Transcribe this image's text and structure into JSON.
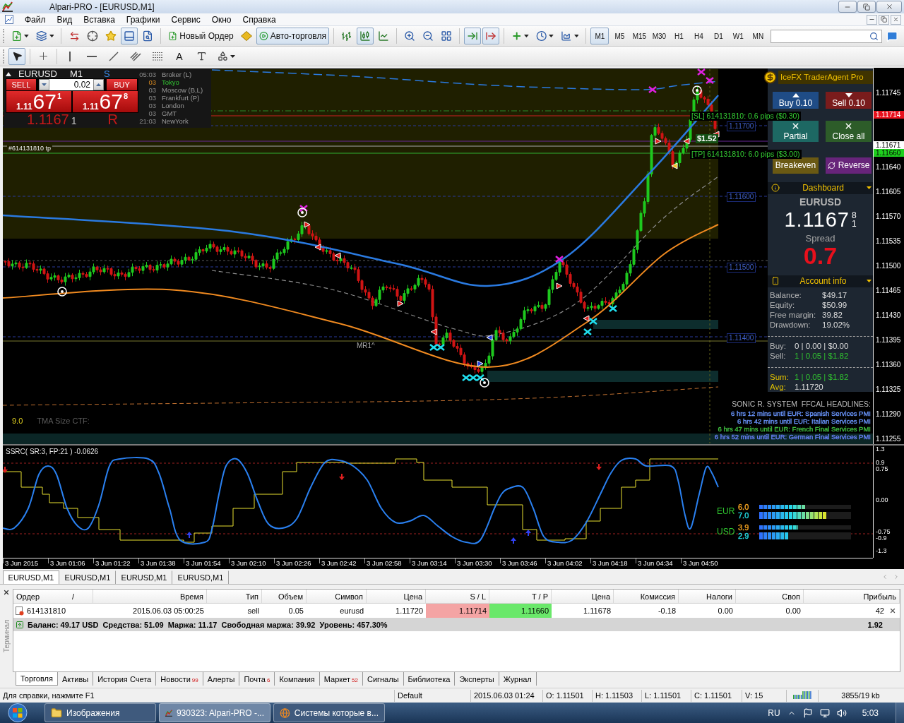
{
  "window": {
    "title": "Alpari-PRO - [EURUSD,M1]"
  },
  "menu": [
    "Файл",
    "Вид",
    "Вставка",
    "Графики",
    "Сервис",
    "Окно",
    "Справка"
  ],
  "toolbar": {
    "terminal_view": {
      "on": true
    },
    "new_order": "Новый Ордер",
    "auto_trading": {
      "label": "Авто-торговля",
      "on": true
    },
    "chart_types": [
      {
        "kind": "bars",
        "selected": false
      },
      {
        "kind": "candles",
        "selected": true
      },
      {
        "kind": "line",
        "selected": false
      }
    ],
    "auto_scroll": {
      "on": true
    },
    "chart_shift": {
      "on": true
    },
    "timeframes": [
      {
        "label": "M1",
        "selected": true
      },
      {
        "label": "M5",
        "selected": false
      },
      {
        "label": "M15",
        "selected": false
      },
      {
        "label": "M30",
        "selected": false
      },
      {
        "label": "H1",
        "selected": false
      },
      {
        "label": "H4",
        "selected": false
      },
      {
        "label": "D1",
        "selected": false
      },
      {
        "label": "W1",
        "selected": false
      },
      {
        "label": "MN",
        "selected": false
      }
    ]
  },
  "drawing_tools": [
    {
      "kind": "cursor",
      "selected": true
    },
    {
      "kind": "crosshair",
      "selected": false
    },
    {
      "kind": "vertical_line",
      "selected": false
    },
    {
      "kind": "horizontal_line",
      "selected": false
    },
    {
      "kind": "trend_line",
      "selected": false
    },
    {
      "kind": "channel",
      "selected": false
    },
    {
      "kind": "fibonacci",
      "selected": false
    },
    {
      "kind": "text",
      "label": "A",
      "selected": false
    },
    {
      "kind": "text_label",
      "selected": false
    },
    {
      "kind": "shapes",
      "selected": false
    }
  ],
  "chart": {
    "symbol": "EURUSD",
    "timeframe": "M1",
    "session_mark": "S",
    "clocks": [
      {
        "time": "05:03",
        "city": "Broker (L)",
        "active": false
      },
      {
        "time": "03",
        "city": "Tokyo",
        "active": true
      },
      {
        "time": "03",
        "city": "Moscow (B,L)",
        "active": false
      },
      {
        "time": "03",
        "city": "Frankfurt (P)",
        "active": false
      },
      {
        "time": "03",
        "city": "London",
        "active": false
      },
      {
        "time": "03",
        "city": "GMT",
        "active": false
      },
      {
        "time": "21:03",
        "city": "NewYork",
        "active": false
      }
    ],
    "one_click": {
      "sell_label": "SELL",
      "buy_label": "BUY",
      "lot": "0.02",
      "bid": {
        "handle": "1.11",
        "pips": "67",
        "fraction": "1"
      },
      "ask": {
        "handle": "1.11",
        "pips": "67",
        "fraction": "8"
      }
    },
    "last_price": {
      "price": "1.1167",
      "digit": "1",
      "mark": "R"
    },
    "order_tag": "#614131810 tp",
    "level_tags": [
      "1.11700",
      "1.11600",
      "1.11500",
      "1.11400"
    ],
    "sl_tag": "[SL] 614131810: 0.6 pips ($0.30)",
    "profit_tag": "$1.52",
    "tp_tag": "[TP] 614131810: 6.0 pips ($3.00)",
    "pivot_tag": "MR1^",
    "tma": {
      "value": "9.0",
      "label": "TMA Size CTF:"
    },
    "price_axis": [
      "1.11745",
      "1.11640",
      "1.11605",
      "1.11570",
      "1.11535",
      "1.11500",
      "1.11465",
      "1.11430",
      "1.11395",
      "1.11360",
      "1.11325",
      "1.11290",
      "1.11255"
    ],
    "price_badges": [
      {
        "label": "1.11714",
        "color": "#e8101c"
      },
      {
        "label": "1.11671",
        "color": "#ffffff"
      },
      {
        "label": "1.11660",
        "color": "#1ed01e"
      }
    ]
  },
  "trader_agent": {
    "title": "IceFX TraderAgent Pro",
    "buttons": [
      {
        "kind": "buy",
        "label": "Buy 0.10"
      },
      {
        "kind": "sell",
        "label": "Sell 0.10"
      },
      {
        "kind": "partial",
        "label": "Partial"
      },
      {
        "kind": "close",
        "label": "Close all"
      },
      {
        "kind": "breakeven",
        "label": "Breakeven"
      },
      {
        "kind": "reverse",
        "label": "Reverse"
      }
    ],
    "dashboard": {
      "title": "Dashboard",
      "symbol": "EURUSD",
      "price": "1.1167",
      "price_sup": "8",
      "price_sub": "1",
      "spread_label": "Spread",
      "spread": "0.7"
    },
    "account": {
      "title": "Account info",
      "rows": [
        {
          "label": "Balance:",
          "value": "$49.17"
        },
        {
          "label": "Equity:",
          "value": "$50.99"
        },
        {
          "label": "Free margin:",
          "value": "39.82"
        },
        {
          "label": "Drawdown:",
          "value": "19.02%"
        }
      ],
      "positions": [
        {
          "label": "Buy:",
          "value": "0 | 0.00 | $0.00",
          "positive": false
        },
        {
          "label": "Sell:",
          "value": "1 | 0.05 | $1.82",
          "positive": true
        }
      ],
      "totals": [
        {
          "label": "Sum:",
          "value": "1 | 0.05 | $1.82",
          "positive": true
        },
        {
          "label": "Avg:",
          "value": "1.11720",
          "positive": false
        }
      ]
    }
  },
  "headlines": {
    "title": "SONIC R. SYSTEM  FFCAL HEADLINES:",
    "items": [
      {
        "text": "6 hrs 12 mins until EUR: Spanish Services PMI",
        "color": "#6a96ff"
      },
      {
        "text": "6 hrs 42 mins until EUR: Italian Services PMI",
        "color": "#6a96ff"
      },
      {
        "text": "6 hrs 47 mins until EUR: French Final Services PMI",
        "color": "#40c040"
      },
      {
        "text": "6 hrs 52 mins until EUR: German Final Services PMI",
        "color": "#6a84ff"
      }
    ]
  },
  "oscillator": {
    "title": "SSRC( SR:3, FP:21 ) -0.0626",
    "axis": [
      "1.3",
      "0.9",
      "0.75",
      "0.00",
      "-0.75",
      "-0.9",
      "-1.3"
    ],
    "strength": [
      {
        "currency": "EUR",
        "meters": [
          {
            "reading": "6.0",
            "level": 0.5,
            "color": "#f0a020"
          },
          {
            "reading": "7.0",
            "level": 0.74,
            "color": "#20d8e0"
          }
        ]
      },
      {
        "currency": "USD",
        "meters": [
          {
            "reading": "3.9",
            "level": 0.42,
            "color": "#f0a020"
          },
          {
            "reading": "2.9",
            "level": 0.32,
            "color": "#20d8e0"
          }
        ]
      }
    ]
  },
  "time_axis": [
    "3 Jun 2015",
    "3 Jun 01:06",
    "3 Jun 01:22",
    "3 Jun 01:38",
    "3 Jun 01:54",
    "3 Jun 02:10",
    "3 Jun 02:26",
    "3 Jun 02:42",
    "3 Jun 02:58",
    "3 Jun 03:14",
    "3 Jun 03:30",
    "3 Jun 03:46",
    "3 Jun 04:02",
    "3 Jun 04:18",
    "3 Jun 04:34",
    "3 Jun 04:50"
  ],
  "chart_tabs": [
    {
      "label": "EURUSD,M1",
      "selected": true
    },
    {
      "label": "EURUSD,M1",
      "selected": false
    },
    {
      "label": "EURUSD,M1",
      "selected": false
    },
    {
      "label": "EURUSD,M1",
      "selected": false
    }
  ],
  "terminal": {
    "title": "Терминал",
    "columns": [
      "Ордер",
      "Время",
      "Тип",
      "Объем",
      "Символ",
      "Цена",
      "S / L",
      "T / P",
      "Цена",
      "Комиссия",
      "Налоги",
      "Своп",
      "Прибыль"
    ],
    "sort_indicator": "/",
    "orders": [
      {
        "cells": [
          "614131810",
          "2015.06.03 05:00:25",
          "sell",
          "0.05",
          "eurusd",
          "1.11720",
          "1.11714",
          "1.11660",
          "1.11678",
          "-0.18",
          "0.00",
          "0.00",
          "42"
        ]
      }
    ],
    "summary": {
      "text": "Баланс: 49.17 USD  Средства: 51.09  Маржа: 11.17  Свободная маржа: 39.92  Уровень: 457.30%",
      "profit": "1.92"
    },
    "tabs": [
      {
        "label": "Торговля",
        "selected": true
      },
      {
        "label": "Активы",
        "selected": false
      },
      {
        "label": "История Счета",
        "selected": false
      },
      {
        "label": "Новости",
        "badge": "99",
        "selected": false
      },
      {
        "label": "Алерты",
        "selected": false
      },
      {
        "label": "Почта",
        "badge": "6",
        "selected": false
      },
      {
        "label": "Компания",
        "selected": false
      },
      {
        "label": "Маркет",
        "badge": "52",
        "selected": false
      },
      {
        "label": "Сигналы",
        "selected": false
      },
      {
        "label": "Библиотека",
        "selected": false
      },
      {
        "label": "Эксперты",
        "selected": false
      },
      {
        "label": "Журнал",
        "selected": false
      }
    ]
  },
  "status_bar": {
    "help": "Для справки, нажмите F1",
    "profile": "Default",
    "bar_time": "2015.06.03 01:24",
    "open": "O: 1.11501",
    "high": "H: 1.11503",
    "low": "L: 1.11501",
    "close": "C: 1.11501",
    "volume": "V: 15",
    "traffic": "3855/19 kb"
  },
  "taskbar": {
    "buttons": [
      {
        "kind": "folder",
        "label": "Изображения",
        "selected": false
      },
      {
        "kind": "terminal",
        "label": "930323: Alpari-PRO -...",
        "selected": true
      },
      {
        "kind": "browser",
        "label": "Системы которые в...",
        "selected": false
      }
    ],
    "language": "RU",
    "clock": "5:03"
  }
}
